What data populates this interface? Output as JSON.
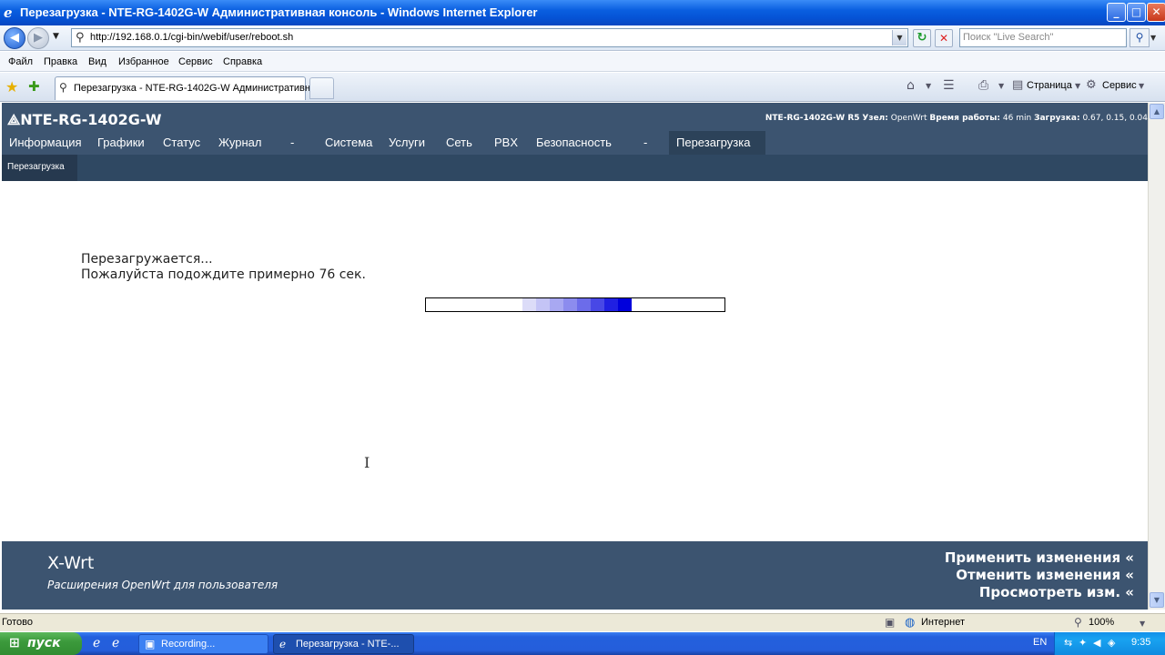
{
  "window": {
    "title": "Перезагрузка - NTE-RG-1402G-W Административная консоль - Windows Internet Explorer",
    "min_icon": "minimize-icon",
    "max_icon": "maximize-icon",
    "close_icon": "close-icon"
  },
  "address_bar": {
    "url": "http://192.168.0.1/cgi-bin/webif/user/reboot.sh",
    "search_placeholder": "Поиск \"Live Search\""
  },
  "menu": [
    "Файл",
    "Правка",
    "Вид",
    "Избранное",
    "Сервис",
    "Справка"
  ],
  "tabs": {
    "active_label": "Перезагрузка - NTE-RG-1402G-W Административн..."
  },
  "command_bar": {
    "page": "Страница",
    "tools": "Сервис"
  },
  "site": {
    "logo": "NTE-RG-1402G-W",
    "sysinfo": {
      "model": "NTE-RG-1402G-W R5",
      "host_label": "Узел:",
      "host": "OpenWrt",
      "uptime_label": "Время работы:",
      "uptime": "46 min",
      "load_label": "Загрузка:",
      "load": "0.67, 0.15, 0.04"
    },
    "nav": [
      "Информация",
      "Графики",
      "Статус",
      "Журнал",
      "-",
      "Система",
      "Услуги",
      "Сеть",
      "PBX",
      "Безопасность",
      "-",
      "Перезагрузка"
    ],
    "nav_active": "Перезагрузка",
    "subnav": "Перезагрузка",
    "message_line1": "Перезагружается...",
    "message_line2": "Пожалуйста подождите примерно 76 сек.",
    "progress_colors": [
      "#dcdcf8",
      "#c4c4f6",
      "#a8a8f2",
      "#8c8cee",
      "#6c6cea",
      "#4848e6",
      "#2020e2",
      "#0000dc"
    ],
    "footer": {
      "title": "X-Wrt",
      "subtitle": "Расширения OpenWrt для пользователя",
      "links": [
        "Применить изменения «",
        "Отменить изменения «",
        "Просмотреть изм. «"
      ]
    }
  },
  "status_bar": {
    "status": "Готово",
    "zone": "Интернет",
    "zoom": "100%"
  },
  "taskbar": {
    "start": "пуск",
    "tasks": [
      "Recording...",
      "Перезагрузка - NTE-..."
    ],
    "lang": "EN",
    "clock": "9:35"
  }
}
